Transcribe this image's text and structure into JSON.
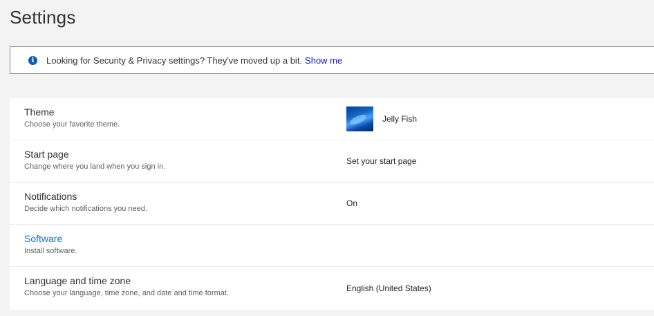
{
  "page": {
    "title": "Settings"
  },
  "notice": {
    "icon": "info-icon",
    "text": "Looking for Security & Privacy settings? They've moved up a bit.",
    "link_label": "Show me"
  },
  "settings": [
    {
      "title": "Theme",
      "description": "Choose your favorite theme.",
      "value": "Jelly Fish"
    },
    {
      "title": "Start page",
      "description": "Change where you land when you sign in.",
      "value": "Set your start page"
    },
    {
      "title": "Notifications",
      "description": "Decide which notifications you need.",
      "value": "On"
    },
    {
      "title": "Software",
      "description": "Install software.",
      "value": ""
    },
    {
      "title": "Language and time zone",
      "description": "Choose your language, time zone, and date and time format.",
      "value": "English (United States)"
    }
  ],
  "colors": {
    "background": "#f3f3f3",
    "link": "#1a1aa8",
    "row_link": "#1b6ec2",
    "info": "#0f5ba9"
  }
}
